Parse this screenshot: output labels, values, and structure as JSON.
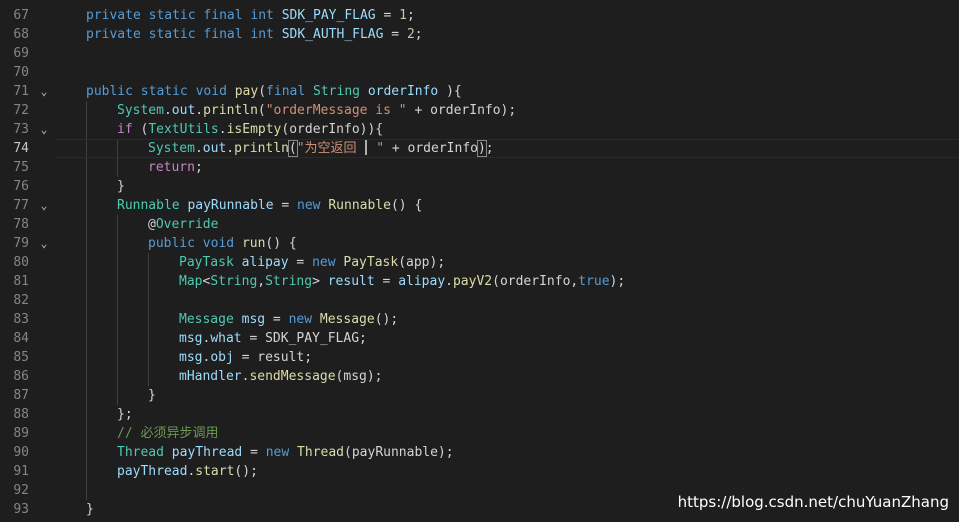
{
  "editor": {
    "current_line": "74",
    "lines": [
      {
        "num": "67",
        "fold": "",
        "indent": 0,
        "tokens": [
          [
            "kw",
            "private "
          ],
          [
            "kw",
            "static "
          ],
          [
            "kw",
            "final "
          ],
          [
            "kw",
            "int "
          ],
          [
            "var",
            "SDK_PAY_FLAG"
          ],
          [
            "plain",
            " = "
          ],
          [
            "num",
            "1"
          ],
          [
            "plain",
            ";"
          ]
        ]
      },
      {
        "num": "68",
        "fold": "",
        "indent": 0,
        "tokens": [
          [
            "kw",
            "private "
          ],
          [
            "kw",
            "static "
          ],
          [
            "kw",
            "final "
          ],
          [
            "kw",
            "int "
          ],
          [
            "var",
            "SDK_AUTH_FLAG"
          ],
          [
            "plain",
            " = "
          ],
          [
            "num",
            "2"
          ],
          [
            "plain",
            ";"
          ]
        ]
      },
      {
        "num": "69",
        "fold": "",
        "indent": 0,
        "tokens": []
      },
      {
        "num": "70",
        "fold": "",
        "indent": 0,
        "tokens": []
      },
      {
        "num": "71",
        "fold": "chevron-down",
        "indent": 0,
        "tokens": [
          [
            "kw",
            "public "
          ],
          [
            "kw",
            "static "
          ],
          [
            "kw",
            "void "
          ],
          [
            "fn",
            "pay"
          ],
          [
            "plain",
            "("
          ],
          [
            "kw",
            "final "
          ],
          [
            "type",
            "String "
          ],
          [
            "var",
            "orderInfo"
          ],
          [
            "plain",
            " ){"
          ]
        ]
      },
      {
        "num": "72",
        "fold": "",
        "indent": 1,
        "tokens": [
          [
            "type",
            "System"
          ],
          [
            "plain",
            "."
          ],
          [
            "var",
            "out"
          ],
          [
            "plain",
            "."
          ],
          [
            "fn",
            "println"
          ],
          [
            "plain",
            "("
          ],
          [
            "str",
            "\"orderMessage is \""
          ],
          [
            "plain",
            " + orderInfo);"
          ]
        ]
      },
      {
        "num": "73",
        "fold": "chevron-down",
        "indent": 1,
        "tokens": [
          [
            "ctrl",
            "if "
          ],
          [
            "plain",
            "("
          ],
          [
            "type",
            "TextUtils"
          ],
          [
            "plain",
            "."
          ],
          [
            "fn",
            "isEmpty"
          ],
          [
            "plain",
            "(orderInfo)){"
          ]
        ]
      },
      {
        "num": "74",
        "fold": "",
        "indent": 2,
        "tokens": [
          [
            "type",
            "System"
          ],
          [
            "plain",
            "."
          ],
          [
            "var",
            "out"
          ],
          [
            "plain",
            "."
          ],
          [
            "fn",
            "println"
          ],
          [
            "bracket",
            "("
          ],
          [
            "str",
            "\"为空返回 "
          ],
          [
            "caret",
            ""
          ],
          [
            "str",
            " \""
          ],
          [
            "plain",
            " + orderInfo"
          ],
          [
            "bracket",
            ")"
          ],
          [
            "plain",
            ";"
          ]
        ]
      },
      {
        "num": "75",
        "fold": "",
        "indent": 2,
        "tokens": [
          [
            "ctrl",
            "return"
          ],
          [
            "plain",
            ";"
          ]
        ]
      },
      {
        "num": "76",
        "fold": "",
        "indent": 1,
        "tokens": [
          [
            "plain",
            "}"
          ]
        ]
      },
      {
        "num": "77",
        "fold": "chevron-down",
        "indent": 1,
        "tokens": [
          [
            "type",
            "Runnable "
          ],
          [
            "var",
            "payRunnable"
          ],
          [
            "plain",
            " = "
          ],
          [
            "kw",
            "new "
          ],
          [
            "fn",
            "Runnable"
          ],
          [
            "plain",
            "() {"
          ]
        ]
      },
      {
        "num": "78",
        "fold": "",
        "indent": 2,
        "tokens": [
          [
            "plain",
            "@"
          ],
          [
            "type",
            "Override"
          ]
        ]
      },
      {
        "num": "79",
        "fold": "chevron-down",
        "indent": 2,
        "tokens": [
          [
            "kw",
            "public "
          ],
          [
            "kw",
            "void "
          ],
          [
            "fn",
            "run"
          ],
          [
            "plain",
            "() {"
          ]
        ]
      },
      {
        "num": "80",
        "fold": "",
        "indent": 3,
        "tokens": [
          [
            "type",
            "PayTask "
          ],
          [
            "var",
            "alipay"
          ],
          [
            "plain",
            " = "
          ],
          [
            "kw",
            "new "
          ],
          [
            "fn",
            "PayTask"
          ],
          [
            "plain",
            "(app);"
          ]
        ]
      },
      {
        "num": "81",
        "fold": "",
        "indent": 3,
        "tokens": [
          [
            "type",
            "Map"
          ],
          [
            "plain",
            "<"
          ],
          [
            "type",
            "String"
          ],
          [
            "plain",
            ","
          ],
          [
            "type",
            "String"
          ],
          [
            "plain",
            "> "
          ],
          [
            "var",
            "result"
          ],
          [
            "plain",
            " = "
          ],
          [
            "var",
            "alipay"
          ],
          [
            "plain",
            "."
          ],
          [
            "fn",
            "payV2"
          ],
          [
            "plain",
            "(orderInfo,"
          ],
          [
            "kw",
            "true"
          ],
          [
            "plain",
            ");"
          ]
        ]
      },
      {
        "num": "82",
        "fold": "",
        "indent": 3,
        "tokens": []
      },
      {
        "num": "83",
        "fold": "",
        "indent": 3,
        "tokens": [
          [
            "type",
            "Message "
          ],
          [
            "var",
            "msg"
          ],
          [
            "plain",
            " = "
          ],
          [
            "kw",
            "new "
          ],
          [
            "fn",
            "Message"
          ],
          [
            "plain",
            "();"
          ]
        ]
      },
      {
        "num": "84",
        "fold": "",
        "indent": 3,
        "tokens": [
          [
            "var",
            "msg"
          ],
          [
            "plain",
            "."
          ],
          [
            "var",
            "what"
          ],
          [
            "plain",
            " = SDK_PAY_FLAG;"
          ]
        ]
      },
      {
        "num": "85",
        "fold": "",
        "indent": 3,
        "tokens": [
          [
            "var",
            "msg"
          ],
          [
            "plain",
            "."
          ],
          [
            "var",
            "obj"
          ],
          [
            "plain",
            " = result;"
          ]
        ]
      },
      {
        "num": "86",
        "fold": "",
        "indent": 3,
        "tokens": [
          [
            "var",
            "mHandler"
          ],
          [
            "plain",
            "."
          ],
          [
            "fn",
            "sendMessage"
          ],
          [
            "plain",
            "(msg);"
          ]
        ]
      },
      {
        "num": "87",
        "fold": "",
        "indent": 2,
        "tokens": [
          [
            "plain",
            "}"
          ]
        ]
      },
      {
        "num": "88",
        "fold": "",
        "indent": 1,
        "tokens": [
          [
            "plain",
            "};"
          ]
        ]
      },
      {
        "num": "89",
        "fold": "",
        "indent": 1,
        "tokens": [
          [
            "cmt",
            "// 必须异步调用"
          ]
        ]
      },
      {
        "num": "90",
        "fold": "",
        "indent": 1,
        "tokens": [
          [
            "type",
            "Thread "
          ],
          [
            "var",
            "payThread"
          ],
          [
            "plain",
            " = "
          ],
          [
            "kw",
            "new "
          ],
          [
            "fn",
            "Thread"
          ],
          [
            "plain",
            "(payRunnable);"
          ]
        ]
      },
      {
        "num": "91",
        "fold": "",
        "indent": 1,
        "tokens": [
          [
            "var",
            "payThread"
          ],
          [
            "plain",
            "."
          ],
          [
            "fn",
            "start"
          ],
          [
            "plain",
            "();"
          ]
        ]
      },
      {
        "num": "92",
        "fold": "",
        "indent": 1,
        "tokens": []
      },
      {
        "num": "93",
        "fold": "",
        "indent": 0,
        "tokens": [
          [
            "plain",
            "}"
          ]
        ]
      }
    ]
  },
  "watermark": "https://blog.csdn.net/chuYuanZhang",
  "colors": {
    "background": "#1e1e1e",
    "keyword": "#569cd6",
    "control": "#c586c0",
    "type": "#4ec9b0",
    "variable": "#9cdcfe",
    "function": "#dcdcaa",
    "string": "#ce9178",
    "number": "#b5cea8",
    "comment": "#6a9955"
  }
}
